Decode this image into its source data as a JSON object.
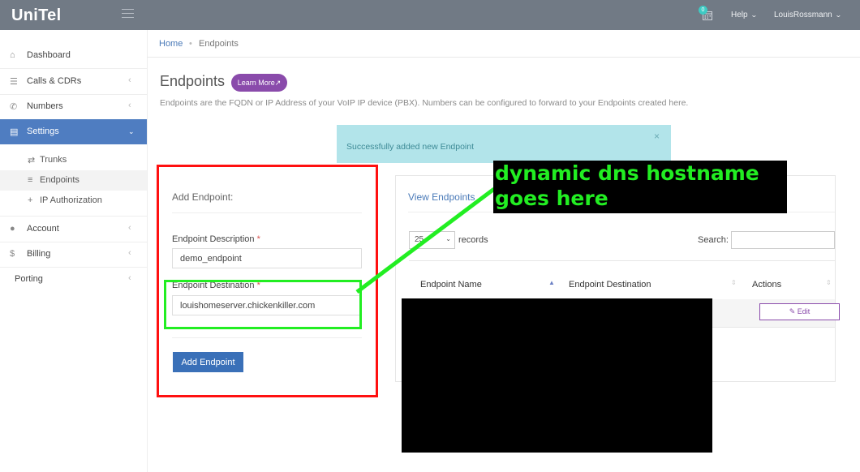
{
  "app": {
    "brand": "UniTel"
  },
  "topbar": {
    "notification_count": "0",
    "help_label": "Help",
    "user_name": "LouisRossmann"
  },
  "sidebar": {
    "items": [
      {
        "label": "Dashboard",
        "icon": "home-icon"
      },
      {
        "label": "Calls & CDRs",
        "icon": "list-icon"
      },
      {
        "label": "Numbers",
        "icon": "phone-icon"
      },
      {
        "label": "Settings",
        "icon": "settings-icon",
        "active": true
      },
      {
        "label": "Account",
        "icon": "user-icon"
      },
      {
        "label": "Billing",
        "icon": "dollar-icon"
      },
      {
        "label": "Porting",
        "icon": ""
      }
    ],
    "subitems": [
      {
        "label": "Trunks",
        "icon": "arrows-icon"
      },
      {
        "label": "Endpoints",
        "icon": "list-icon",
        "selected": true
      },
      {
        "label": "IP Authorization",
        "icon": "plus-icon"
      }
    ]
  },
  "breadcrumb": {
    "home": "Home",
    "separator": "•",
    "current": "Endpoints"
  },
  "page": {
    "title": "Endpoints",
    "learn_more": "Learn More",
    "description": "Endpoints are the FQDN or IP Address of your VoIP IP device (PBX). Numbers can be configured to forward to your Endpoints created here."
  },
  "alert": {
    "message": "Successfully added new Endpoint",
    "close": "×"
  },
  "add_endpoint": {
    "title": "Add Endpoint:",
    "description_label": "Endpoint Description",
    "description_value": "demo_endpoint",
    "destination_label": "Endpoint Destination",
    "destination_value": "louishomeserver.chickenkiller.com",
    "required_mark": "*",
    "submit": "Add Endpoint"
  },
  "view_endpoints": {
    "title": "View Endpoints",
    "page_length": "25",
    "records_label": "records",
    "search_label": "Search:",
    "columns": [
      "Endpoint Name",
      "Endpoint Destination",
      "Actions"
    ],
    "edit_label": "Edit"
  },
  "annotation": {
    "text": "dynamic dns hostname goes here",
    "color": "#22ee22"
  },
  "colors": {
    "topbar": "#717a85",
    "accent_blue": "#4f7dc1",
    "purple": "#8a4bab",
    "highlight_red": "#ff1010",
    "highlight_green": "#22ee22"
  }
}
